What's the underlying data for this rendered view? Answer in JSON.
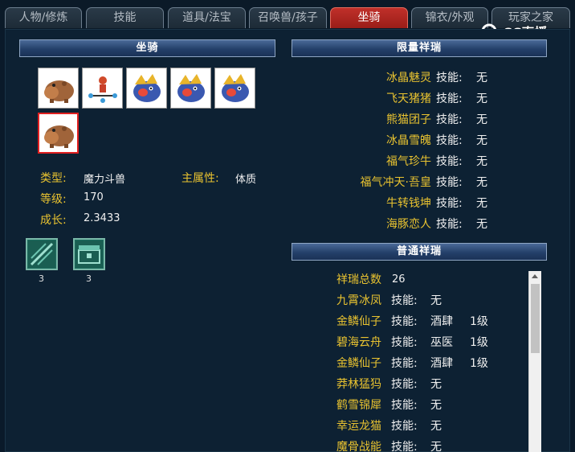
{
  "tabs": [
    {
      "label": "人物/修炼",
      "active": false
    },
    {
      "label": "技能",
      "active": false
    },
    {
      "label": "道具/法宝",
      "active": false
    },
    {
      "label": "召唤兽/孩子",
      "active": false
    },
    {
      "label": "坐骑",
      "active": true
    },
    {
      "label": "锦衣/外观",
      "active": false
    },
    {
      "label": "玩家之家",
      "active": false
    }
  ],
  "logo": {
    "text": "CC直播"
  },
  "mount_panel": {
    "title": "坐骑",
    "info": {
      "type_label": "类型:",
      "type_value": "魔力斗兽",
      "main_attr_label": "主属性:",
      "main_attr_value": "体质",
      "level_label": "等级:",
      "level_value": "170",
      "growth_label": "成长:",
      "growth_value": "2.3433"
    },
    "skills": [
      {
        "icon": "sword-slash-skill-icon",
        "count": "3"
      },
      {
        "icon": "treasure-chest-skill-icon",
        "count": "3"
      }
    ]
  },
  "limited_panel": {
    "title": "限量祥瑞",
    "items": [
      {
        "name": "冰晶魅灵",
        "skill_label": "技能:",
        "skill": "无"
      },
      {
        "name": "飞天猪猪",
        "skill_label": "技能:",
        "skill": "无"
      },
      {
        "name": "熊猫团子",
        "skill_label": "技能:",
        "skill": "无"
      },
      {
        "name": "冰晶雪魄",
        "skill_label": "技能:",
        "skill": "无"
      },
      {
        "name": "福气珍牛",
        "skill_label": "技能:",
        "skill": "无"
      },
      {
        "name": "福气冲天·吾皇",
        "skill_label": "技能:",
        "skill": "无"
      },
      {
        "name": "牛转钱坤",
        "skill_label": "技能:",
        "skill": "无"
      },
      {
        "name": "海豚恋人",
        "skill_label": "技能:",
        "skill": "无"
      }
    ]
  },
  "normal_panel": {
    "title": "普通祥瑞",
    "total_label": "祥瑞总数",
    "total_value": "26",
    "items": [
      {
        "name": "九霄冰凤",
        "skill_label": "技能:",
        "skill": "无",
        "level": ""
      },
      {
        "name": "金鳞仙子",
        "skill_label": "技能:",
        "skill": "酒肆",
        "level": "1级"
      },
      {
        "name": "碧海云舟",
        "skill_label": "技能:",
        "skill": "巫医",
        "level": "1级"
      },
      {
        "name": "金鳞仙子",
        "skill_label": "技能:",
        "skill": "酒肆",
        "level": "1级"
      },
      {
        "name": "莽林猛犸",
        "skill_label": "技能:",
        "skill": "无",
        "level": ""
      },
      {
        "name": "鹤雪锦犀",
        "skill_label": "技能:",
        "skill": "无",
        "level": ""
      },
      {
        "name": "幸运龙猫",
        "skill_label": "技能:",
        "skill": "无",
        "level": ""
      },
      {
        "name": "魔骨战能",
        "skill_label": "技能:",
        "skill": "无",
        "level": ""
      }
    ]
  },
  "colors": {
    "accent_red": "#b02620",
    "label_gold": "#e8c230",
    "panel_blue": "#24406a"
  }
}
